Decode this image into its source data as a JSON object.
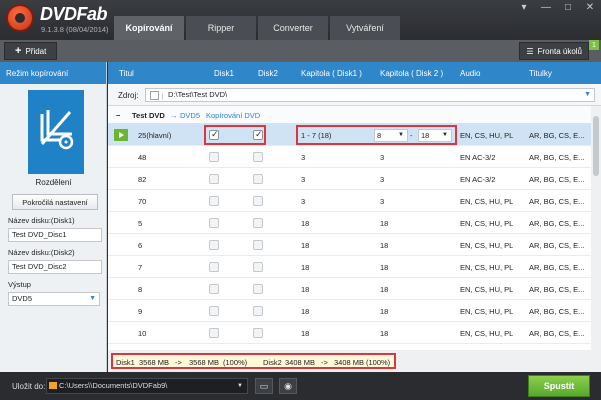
{
  "app": {
    "name": "DVDFab",
    "version": "9.1.3.8 (08/04/2014)"
  },
  "tabs": [
    {
      "label": "Kopírování",
      "active": true
    },
    {
      "label": "Ripper",
      "active": false
    },
    {
      "label": "Converter",
      "active": false
    },
    {
      "label": "Vytváření",
      "active": false
    }
  ],
  "toolbar": {
    "add_label": "Přidat",
    "queue_label": "Fronta úkolů",
    "queue_count": "1"
  },
  "left": {
    "header": "Režim kopírování",
    "mode_label": "Rozdělení",
    "advanced_label": "Pokročilá nastavení",
    "disc1_label": "Název disku:(Disk1)",
    "disc1_value": "Test DVD_Disc1",
    "disc2_label": "Název disku:(Disk2)",
    "disc2_value": "Test DVD_Disc2",
    "output_label": "Výstup",
    "output_value": "DVD5"
  },
  "columns": {
    "title": "Titul",
    "disk1": "Disk1",
    "disk2": "Disk2",
    "ch1": "Kapitola ( Disk1 )",
    "ch2": "Kapitola ( Disk 2 )",
    "audio": "Audio",
    "subs": "Titulky"
  },
  "source": {
    "label": "Zdroj:",
    "path": "D:\\Test\\Test DVD\\"
  },
  "title_row": {
    "name": "Test DVD",
    "arrow": "→",
    "format": "DVD5",
    "mode": "Kopírování DVD"
  },
  "rows": [
    {
      "title": "25(hlavní)",
      "d1": true,
      "d2": true,
      "ch1": "1 - 7 (18)",
      "ch2_from": "8",
      "ch2_to": "18",
      "audio": "EN, CS, HU, PL",
      "subs": "AR, BG, CS, E..."
    },
    {
      "title": "48",
      "ch1": "3",
      "ch2": "3",
      "audio": "EN AC-3/2",
      "subs": "AR, BG, CS, E..."
    },
    {
      "title": "82",
      "ch1": "3",
      "ch2": "3",
      "audio": "EN AC-3/2",
      "subs": "AR, BG, CS, E..."
    },
    {
      "title": "70",
      "ch1": "3",
      "ch2": "3",
      "audio": "EN, CS, HU, PL",
      "subs": "AR, BG, CS, E..."
    },
    {
      "title": "5",
      "ch1": "18",
      "ch2": "18",
      "audio": "EN, CS, HU, PL",
      "subs": "AR, BG, CS, E..."
    },
    {
      "title": "6",
      "ch1": "18",
      "ch2": "18",
      "audio": "EN, CS, HU, PL",
      "subs": "AR, BG, CS, E..."
    },
    {
      "title": "7",
      "ch1": "18",
      "ch2": "18",
      "audio": "EN, CS, HU, PL",
      "subs": "AR, BG, CS, E..."
    },
    {
      "title": "8",
      "ch1": "18",
      "ch2": "18",
      "audio": "EN, CS, HU, PL",
      "subs": "AR, BG, CS, E..."
    },
    {
      "title": "9",
      "ch1": "18",
      "ch2": "18",
      "audio": "EN, CS, HU, PL",
      "subs": "AR, BG, CS, E..."
    },
    {
      "title": "10",
      "ch1": "18",
      "ch2": "18",
      "audio": "EN, CS, HU, PL",
      "subs": "AR, BG, CS, E..."
    }
  ],
  "sizebar": {
    "d1_label": "Disk1",
    "d1_from": "3568 MB",
    "d1_arrow": "->",
    "d1_to": "3568 MB",
    "d1_pct": "(100%)",
    "d2_label": "Disk2",
    "d2_from": "3408 MB",
    "d2_arrow": "->",
    "d2_to": "3408 MB",
    "d2_pct": "(100%)"
  },
  "bottom": {
    "save_label": "Uložit do:",
    "path": "C:\\Users\\\\Documents\\DVDFab9\\",
    "start_label": "Spustit"
  },
  "colors": {
    "accent": "#2f86c8",
    "highlight": "#d9363e",
    "start": "#6bb535"
  }
}
